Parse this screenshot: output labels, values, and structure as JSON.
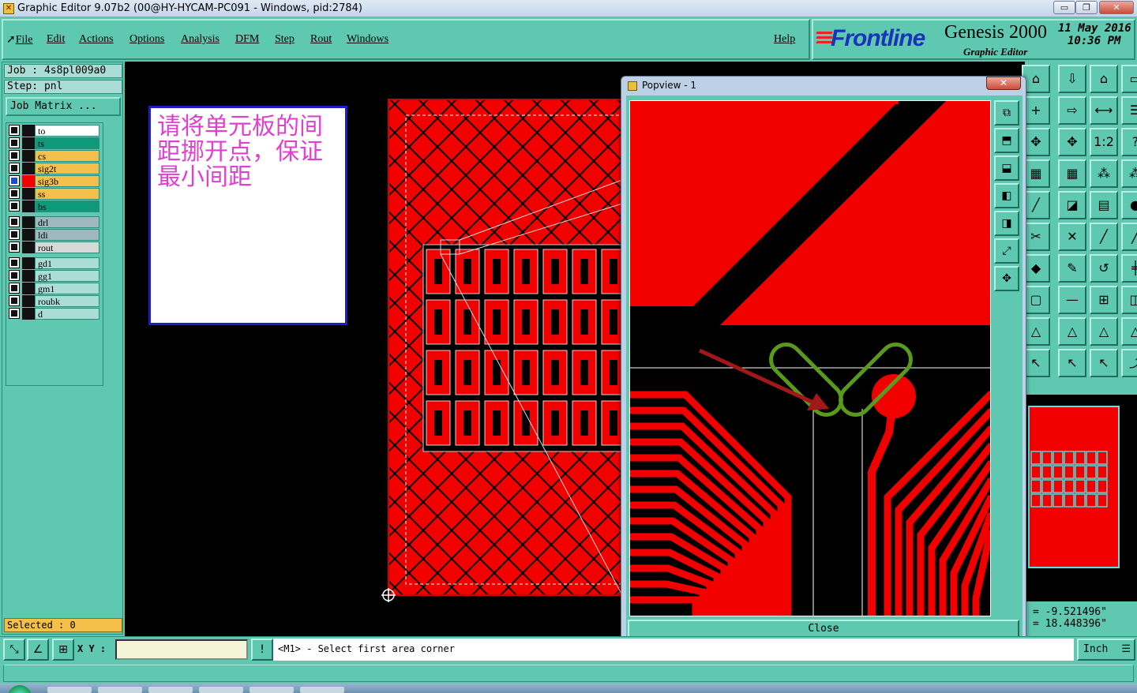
{
  "window": {
    "title": "Graphic Editor 9.07b2 (00@HY-HYCAM-PC091 - Windows, pid:2784)",
    "minimize": "▭",
    "restore": "❐",
    "close": "✕"
  },
  "menu": {
    "file": "File",
    "edit": "Edit",
    "actions": "Actions",
    "options": "Options",
    "analysis": "Analysis",
    "dfm": "DFM",
    "step": "Step",
    "rout": "Rout",
    "windows": "Windows",
    "help": "Help"
  },
  "brand": {
    "logo": "Frontline",
    "product": "Genesis 2000",
    "subtitle": "Graphic Editor",
    "date": "11 May 2016",
    "time": "10:36 PM"
  },
  "left_panel": {
    "job": "Job : 4s8pl009a0",
    "step": "Step: pnl",
    "job_matrix": "Job Matrix ...",
    "selected": "Selected : 0",
    "layers": [
      {
        "name": "to",
        "color": "#ffffff",
        "active": false
      },
      {
        "name": "ts",
        "color": "#0e9a7a",
        "active": false
      },
      {
        "name": "cs",
        "color": "#f3c04c",
        "active": false
      },
      {
        "name": "sig2t",
        "color": "#f3c04c",
        "active": false
      },
      {
        "name": "sig3b",
        "color": "#f3c04c",
        "active": true
      },
      {
        "name": "ss",
        "color": "#f3c04c",
        "active": false
      },
      {
        "name": "bs",
        "color": "#0e9a7a",
        "active": false
      },
      {
        "name": "drl",
        "color": "#9fb8c0",
        "active": false
      },
      {
        "name": "ldi",
        "color": "#9fb8c0",
        "active": false
      },
      {
        "name": "rout",
        "color": "#d8d8d8",
        "active": false
      },
      {
        "name": "gd1",
        "color": "#a9ddd5",
        "active": false
      },
      {
        "name": "gg1",
        "color": "#a9ddd5",
        "active": false
      },
      {
        "name": "gm1",
        "color": "#a9ddd5",
        "active": false
      },
      {
        "name": "roubk",
        "color": "#a9ddd5",
        "active": false
      },
      {
        "name": "d",
        "color": "#a9ddd5",
        "active": false
      }
    ]
  },
  "annotation": {
    "text": "请将单元板的间距挪开点，保证最小间距"
  },
  "popview": {
    "title": "Popview - 1",
    "close_label": "Close"
  },
  "coords": {
    "x": "= -9.521496\"",
    "y": "= 18.448396\""
  },
  "bottom": {
    "xy_label": "X Y :",
    "xy_value": "",
    "prompt": "<M1> - Select first area corner",
    "units": "Inch"
  },
  "colors": {
    "copper": "#f20000",
    "background": "#000000",
    "panel": "#5ec8b0"
  }
}
